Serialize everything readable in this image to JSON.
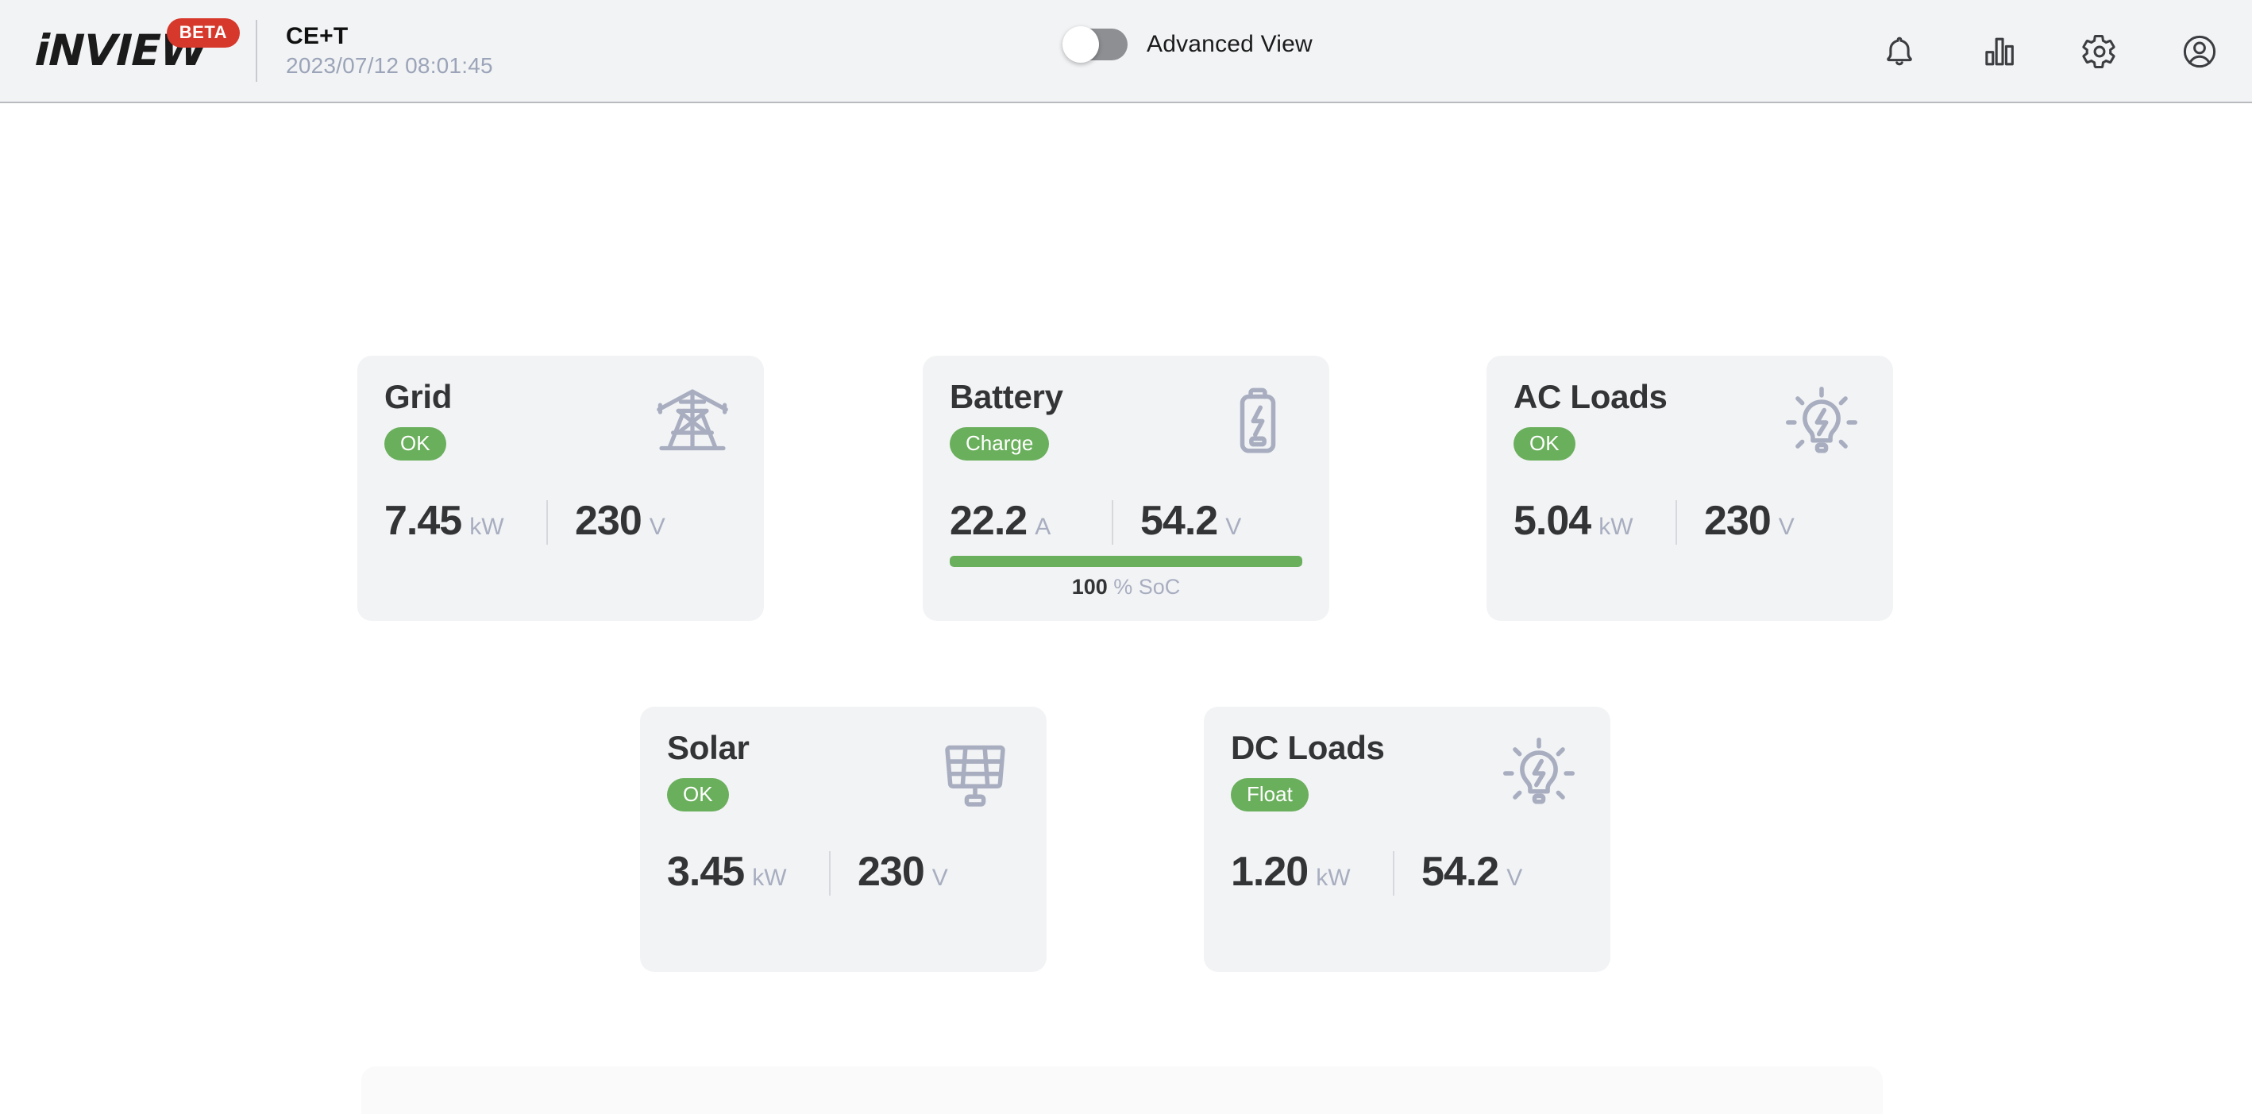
{
  "header": {
    "logo_text": "iNVIEW",
    "beta_label": "BETA",
    "site_name": "CE+T",
    "timestamp": "2023/07/12 08:01:45",
    "advanced_view_label": "Advanced View",
    "advanced_view_enabled": false,
    "icons": [
      {
        "name": "notifications-icon",
        "label": "bell-icon"
      },
      {
        "name": "statistics-icon",
        "label": "bar-chart-icon"
      },
      {
        "name": "settings-icon",
        "label": "gear-icon"
      },
      {
        "name": "account-icon",
        "label": "user-icon"
      }
    ]
  },
  "colors": {
    "accent_green": "#6aaf5c",
    "brand_red": "#d6382c",
    "card_bg": "#f2f3f5",
    "muted_text": "#a8aec0",
    "value_text": "#323436"
  },
  "cards": [
    {
      "id": "grid",
      "title": "Grid",
      "status": "OK",
      "icon": "power-pylon-icon",
      "metrics": [
        {
          "value": "7.45",
          "unit": "kW"
        },
        {
          "value": "230",
          "unit": "V"
        }
      ]
    },
    {
      "id": "battery",
      "title": "Battery",
      "status": "Charge",
      "icon": "battery-charging-icon",
      "metrics": [
        {
          "value": "22.2",
          "unit": "A"
        },
        {
          "value": "54.2",
          "unit": "V"
        }
      ],
      "soc": {
        "percent": 100,
        "value": "100",
        "unit": "% SoC"
      }
    },
    {
      "id": "ac-loads",
      "title": "AC Loads",
      "status": "OK",
      "icon": "light-bulb-icon",
      "metrics": [
        {
          "value": "5.04",
          "unit": "kW"
        },
        {
          "value": "230",
          "unit": "V"
        }
      ]
    },
    {
      "id": "solar",
      "title": "Solar",
      "status": "OK",
      "icon": "solar-panel-icon",
      "metrics": [
        {
          "value": "3.45",
          "unit": "kW"
        },
        {
          "value": "230",
          "unit": "V"
        }
      ]
    },
    {
      "id": "dc-loads",
      "title": "DC Loads",
      "status": "Float",
      "icon": "light-bulb-icon",
      "metrics": [
        {
          "value": "1.20",
          "unit": "kW"
        },
        {
          "value": "54.2",
          "unit": "V"
        }
      ]
    }
  ]
}
